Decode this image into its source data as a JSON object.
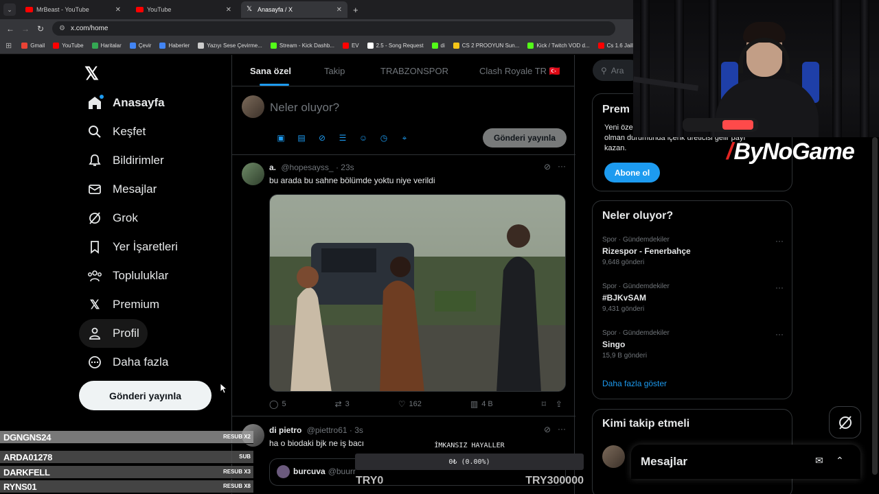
{
  "browser": {
    "tabs": [
      {
        "title": "MrBeast - YouTube",
        "icon": "youtube-icon"
      },
      {
        "title": "YouTube",
        "icon": "youtube-icon"
      },
      {
        "title": "Anasayfa / X",
        "icon": "x-icon"
      }
    ],
    "url": "x.com/home",
    "bookmarks": [
      {
        "label": "Gmail",
        "color": "#ea4335"
      },
      {
        "label": "YouTube",
        "color": "#ff0000"
      },
      {
        "label": "Haritalar",
        "color": "#34a853"
      },
      {
        "label": "Çevir",
        "color": "#4285f4"
      },
      {
        "label": "Haberler",
        "color": "#4285f4"
      },
      {
        "label": "Yazıyı Sese Çevirme...",
        "color": "#cccccc"
      },
      {
        "label": "Stream - Kick Dashb...",
        "color": "#53fc18"
      },
      {
        "label": "EV",
        "color": "#ff0000"
      },
      {
        "label": "2.5 - Song Request",
        "color": "#ffffff"
      },
      {
        "label": "di",
        "color": "#53fc18"
      },
      {
        "label": "CS 2 PROOYUN Sun...",
        "color": "#f5c518"
      },
      {
        "label": "Kick / Twitch VOD d...",
        "color": "#53fc18"
      },
      {
        "label": "Cs 1.6 JailBr",
        "color": "#ff0000"
      }
    ]
  },
  "nav": {
    "items": [
      {
        "label": "Anasayfa",
        "icon": "home-icon"
      },
      {
        "label": "Keşfet",
        "icon": "search-icon"
      },
      {
        "label": "Bildirimler",
        "icon": "bell-icon"
      },
      {
        "label": "Mesajlar",
        "icon": "mail-icon"
      },
      {
        "label": "Grok",
        "icon": "grok-icon"
      },
      {
        "label": "Yer İşaretleri",
        "icon": "bookmark-icon"
      },
      {
        "label": "Topluluklar",
        "icon": "communities-icon"
      },
      {
        "label": "Premium",
        "icon": "x-icon"
      },
      {
        "label": "Profil",
        "icon": "profile-icon"
      },
      {
        "label": "Daha fazla",
        "icon": "more-icon"
      }
    ],
    "post_button": "Gönderi yayınla"
  },
  "feed": {
    "tabs": [
      "Sana özel",
      "Takip",
      "TRABZONSPOR",
      "Clash Royale TR 🇹🇷"
    ],
    "composer": {
      "placeholder": "Neler oluyor?",
      "post_button": "Gönderi yayınla"
    },
    "tweets": [
      {
        "name": "a.",
        "handle": "@hopesayss_",
        "time": "· 23s",
        "text": "bu arada bu sahne bölümde yoktu niye verildi",
        "replies": "5",
        "reposts": "3",
        "likes": "162",
        "views": "4 B"
      },
      {
        "name": "di pietro",
        "handle": "@piettro61",
        "time": "· 3s",
        "text": "ha o biodaki bjk ne iş bacı",
        "quote_name": "burcuva",
        "quote_handle": "@buurr"
      }
    ]
  },
  "sidebar": {
    "search_placeholder": "Ara",
    "premium": {
      "title": "Prem",
      "text_line1": "Yeni öze",
      "text_line2": "olman durumunda içerik üreticisi gelir payı",
      "text_line3": "kazan.",
      "button": "Abone ol"
    },
    "trends": {
      "title": "Neler oluyor?",
      "items": [
        {
          "meta": "Spor · Gündemdekiler",
          "name": "Rizespor - Fenerbahçe",
          "count": "9,648 gönderi"
        },
        {
          "meta": "Spor · Gündemdekiler",
          "name": "#BJKvSAM",
          "count": "9,431 gönderi"
        },
        {
          "meta": "Spor · Gündemdekiler",
          "name": "Singo",
          "count": "15,9 B gönderi"
        }
      ],
      "show_more": "Daha fazla göster"
    },
    "who_to_follow": {
      "title": "Kimi takip etmeli"
    },
    "messages_drawer": "Mesajlar"
  },
  "overlay": {
    "sponsor": "ByNoGame",
    "subs": [
      {
        "name": "DGNGNS24",
        "tag": "RESUB X2"
      },
      {
        "name": "ARDA01278",
        "tag": "SUB"
      },
      {
        "name": "DARKFELL",
        "tag": "RESUB X3"
      },
      {
        "name": "RYNS01",
        "tag": "RESUB X8"
      }
    ],
    "goal": {
      "title": "İMKANSIZ HAYALLER",
      "value_text": "0₺ (0.00%)",
      "progress_pct": 0,
      "min": "TRY0",
      "max": "TRY300000"
    }
  }
}
